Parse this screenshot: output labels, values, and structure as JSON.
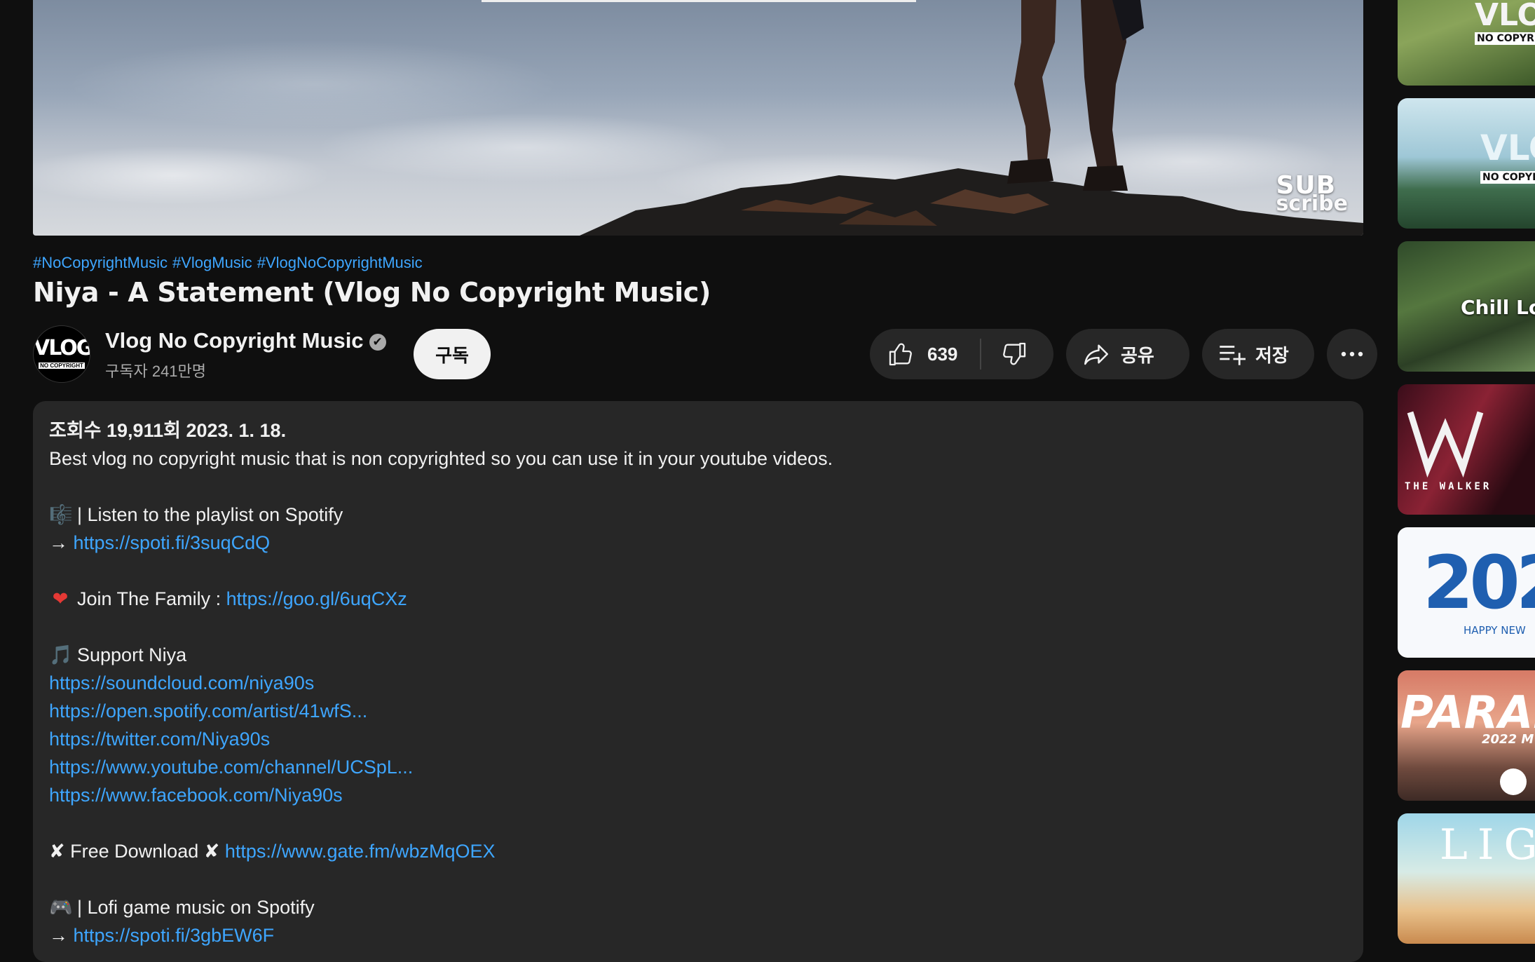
{
  "player": {
    "watermark_line1": "SUB",
    "watermark_line2": "scribe"
  },
  "video": {
    "hashtags": [
      "#NoCopyrightMusic",
      "#VlogMusic",
      "#VlogNoCopyrightMusic"
    ],
    "title": "Niya - A Statement (Vlog No Copyright Music)"
  },
  "channel": {
    "avatar_text": "VLOG",
    "avatar_subtext": "NO COPYRIGHT",
    "name": "Vlog No Copyright Music",
    "verified_mark": "✔",
    "subscribers": "구독자 241만명",
    "subscribe_label": "구독"
  },
  "actions": {
    "like_count": "639",
    "share_label": "공유",
    "save_label": "저장"
  },
  "description": {
    "stats": "조회수 19,911회  2023. 1. 18.",
    "intro": "Best vlog no copyright music that is non copyrighted so you can use it in your youtube videos.",
    "playlist_emoji": "🎼",
    "playlist_text": "| Listen to the playlist on Spotify",
    "arrow": "→",
    "playlist_link": "https://spoti.fi/3suqCdQ",
    "family_emoji": "❤",
    "family_text": "Join The Family : ",
    "family_link": "https://goo.gl/6uqCXz",
    "support_emoji": "🎵",
    "support_text": "Support Niya",
    "support_links": [
      "https://soundcloud.com/niya90s",
      "https://open.spotify.com/artist/41wfS...",
      "https://twitter.com/Niya90s",
      "https://www.youtube.com/channel/UCSpL...",
      "https://www.facebook.com/Niya90s"
    ],
    "download_mark": "✘",
    "download_text": "Free Download",
    "download_link": "https://www.gate.fm/wbzMqOEX",
    "lofi_emoji": "🎮",
    "lofi_text": "| Lofi game music on Spotify",
    "lofi_link": "https://spoti.fi/3gbEW6F"
  },
  "recommendations": [
    {
      "overlay_text": "VLO",
      "overlay_sub": "NO COPYRIG"
    },
    {
      "overlay_text": "VLO",
      "overlay_sub": "NO COPYRIG"
    },
    {
      "overlay_text": "Chill Lofi",
      "overlay_sub": ""
    },
    {
      "overlay_text": "THE WALKER",
      "overlay_sub": ""
    },
    {
      "overlay_text": "202",
      "overlay_sub": "HAPPY NEW"
    },
    {
      "overlay_text": "PARAD",
      "overlay_sub": "2022 M"
    },
    {
      "overlay_text": "LIGH",
      "overlay_sub": ""
    }
  ],
  "colors": {
    "background": "#0f0f0f",
    "surface": "#272727",
    "link": "#3ea6ff",
    "text": "#f1f1f1",
    "muted": "#aaaaaa"
  }
}
